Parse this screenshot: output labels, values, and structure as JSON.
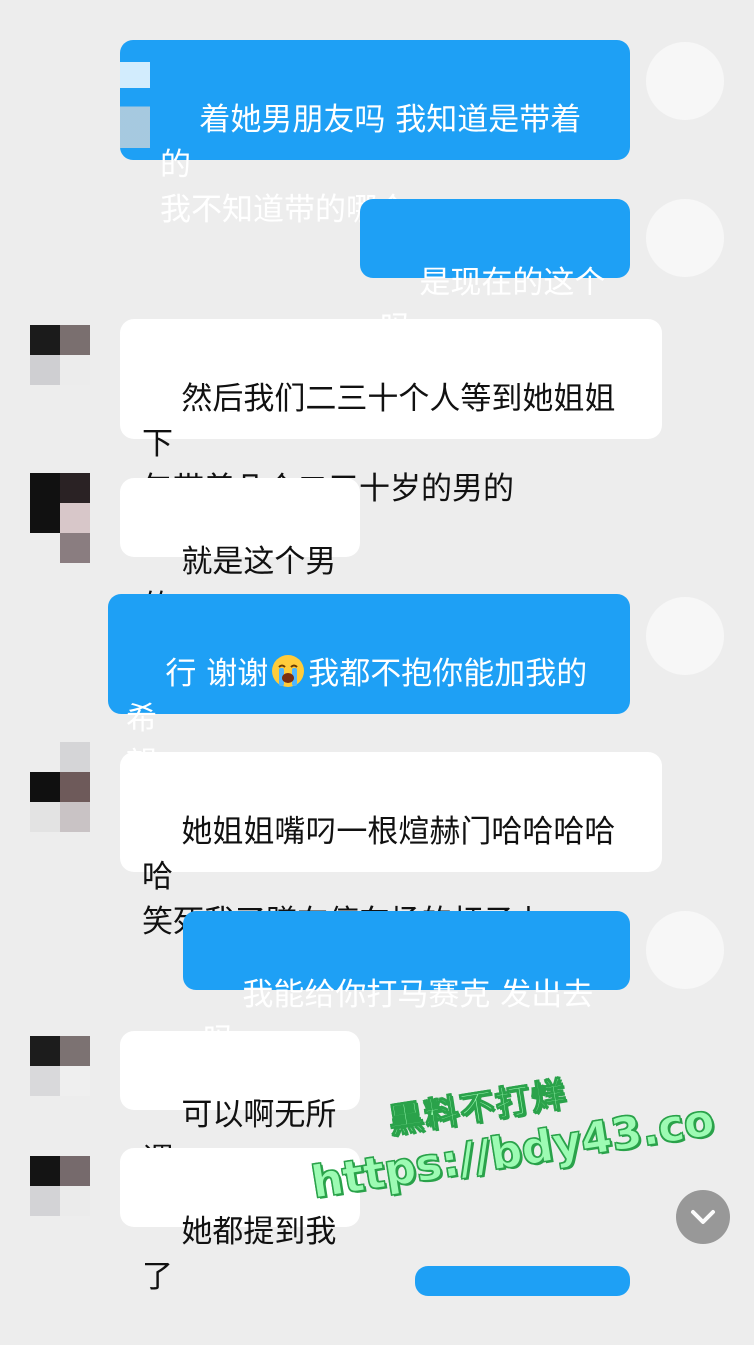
{
  "messages": [
    {
      "side": "out",
      "text": "着她男朋友吗 我知道是带着的\n我不知道带的哪个"
    },
    {
      "side": "out",
      "text": "是现在的这个吗"
    },
    {
      "side": "in",
      "text": "然后我们二三十个人等到她姐姐下\n午带着几个二三十岁的男的"
    },
    {
      "side": "in",
      "text": "就是这个男的"
    },
    {
      "side": "out",
      "text_before_emoji": "行 谢谢",
      "emoji": "crying-face-emoji",
      "text_after_emoji": "我都不抱你能加我的希\n望"
    },
    {
      "side": "in",
      "text": "她姐姐嘴叼一根煊赫门哈哈哈哈哈\n笑死我了蹲在停车场的杆子上"
    },
    {
      "side": "out",
      "text": "我能给你打马赛克 发出去吗"
    },
    {
      "side": "in",
      "text": "可以啊无所谓"
    },
    {
      "side": "in",
      "text": "她都提到我了"
    }
  ],
  "watermark": {
    "line1": "黑料不打烊",
    "line2": "https://bdy43.co"
  },
  "colors": {
    "outgoing_bubble": "#1ea0f5",
    "incoming_bubble": "#ffffff",
    "background": "#ededed"
  },
  "icons": {
    "scroll_down": "chevron-down-icon"
  }
}
